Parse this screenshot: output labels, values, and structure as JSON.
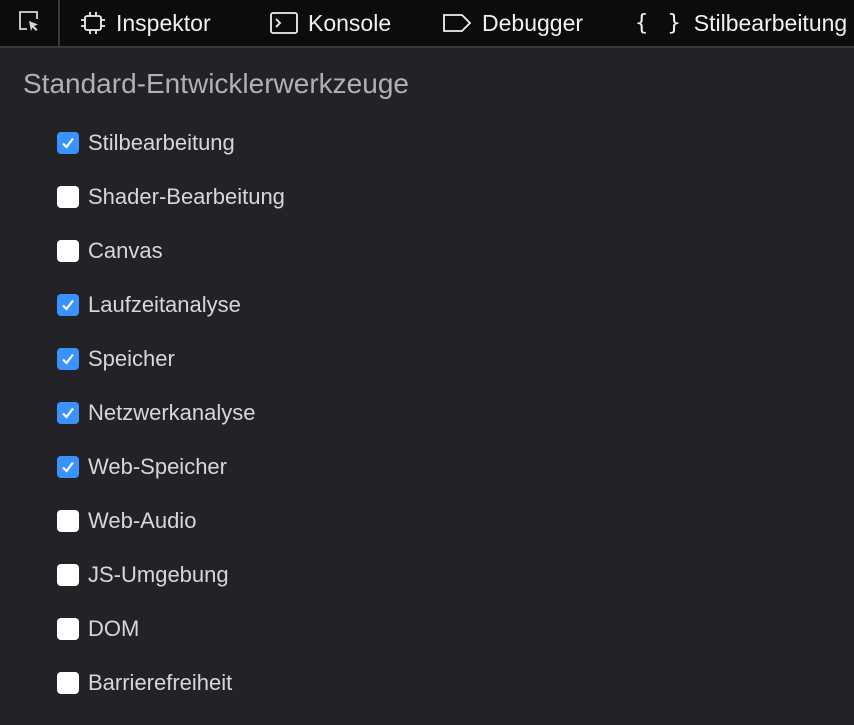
{
  "toolbar": {
    "picker_icon": "element-picker-icon",
    "tabs": [
      {
        "label": "Inspektor",
        "icon": "inspector-icon"
      },
      {
        "label": "Konsole",
        "icon": "console-icon"
      },
      {
        "label": "Debugger",
        "icon": "debugger-icon"
      },
      {
        "label": "Stilbearbeitung",
        "icon": "braces-icon",
        "icon_glyph": "{ }"
      }
    ]
  },
  "settings": {
    "section_title": "Standard-Entwicklerwerkzeuge",
    "tools": [
      {
        "label": "Stilbearbeitung",
        "checked": true
      },
      {
        "label": "Shader-Bearbeitung",
        "checked": false
      },
      {
        "label": "Canvas",
        "checked": false
      },
      {
        "label": "Laufzeitanalyse",
        "checked": true
      },
      {
        "label": "Speicher",
        "checked": true
      },
      {
        "label": "Netzwerkanalyse",
        "checked": true
      },
      {
        "label": "Web-Speicher",
        "checked": true
      },
      {
        "label": "Web-Audio",
        "checked": false
      },
      {
        "label": "JS-Umgebung",
        "checked": false
      },
      {
        "label": "DOM",
        "checked": false
      },
      {
        "label": "Barrierefreiheit",
        "checked": false
      }
    ]
  },
  "colors": {
    "toolbar_bg": "#0c0c0d",
    "panel_bg": "#232327",
    "checkbox_checked": "#3a92ff",
    "checkbox_unchecked": "#ffffff",
    "text": "#d7d7db",
    "title_text": "#b1b1b3"
  }
}
